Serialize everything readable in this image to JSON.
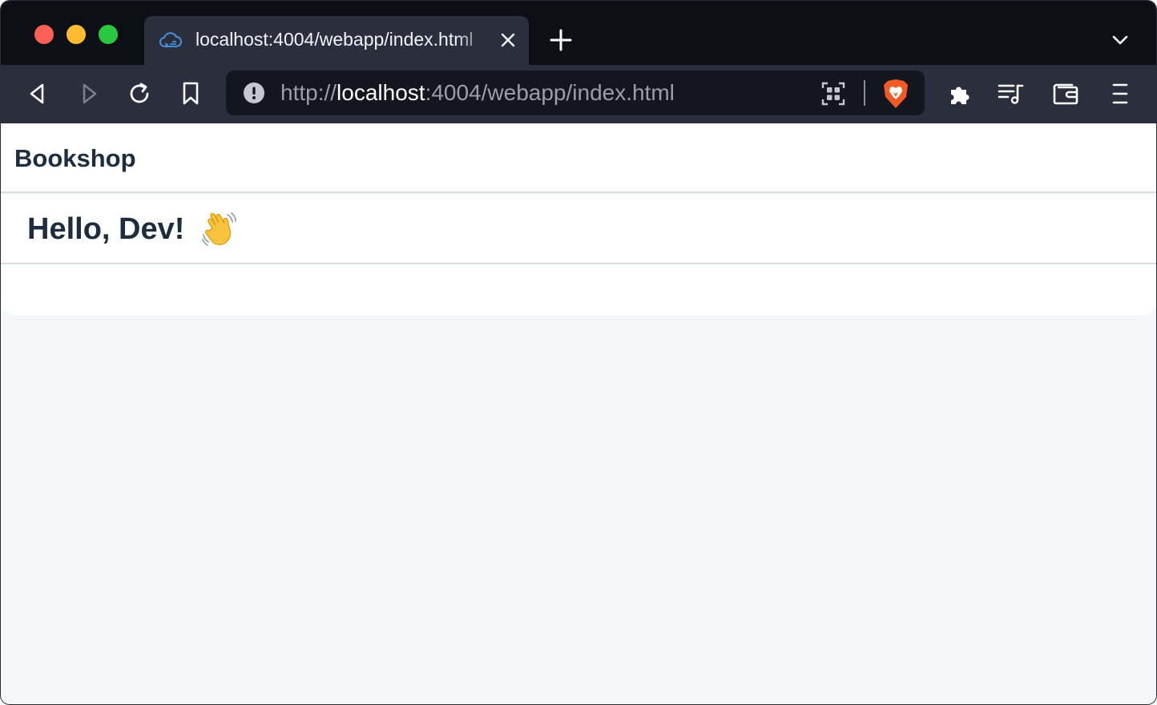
{
  "browser": {
    "tab": {
      "title": "localhost:4004/webapp/index.html",
      "favicon": "cloud-code-icon"
    },
    "url": {
      "scheme": "http://",
      "host": "localhost",
      "rest": ":4004/webapp/index.html"
    },
    "colors": {
      "tabstrip": "#0d0f17",
      "toolbar": "#2b2f3d",
      "urlbar": "#14161f",
      "brave": "#f15a24"
    }
  },
  "app": {
    "title": "Bookshop",
    "greeting": "Hello, Dev!",
    "greeting_icon": "waving-hand-icon",
    "colors": {
      "text": "#1d2d3e",
      "background": "#f5f6f7",
      "divider": "#d9dcdf"
    }
  }
}
